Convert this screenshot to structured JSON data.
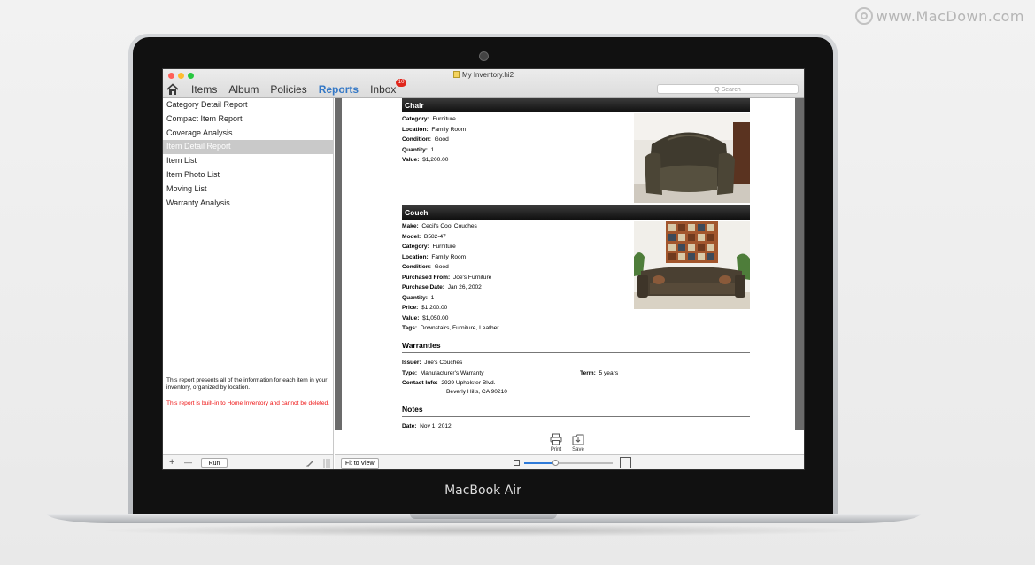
{
  "watermark": {
    "text": "www.MacDown.com"
  },
  "laptop": {
    "brand": "MacBook Air"
  },
  "window": {
    "title": "My Inventory.hi2",
    "traffic_lights": {
      "close": "#ff5f57",
      "minimize": "#febc2e",
      "zoom": "#28c840"
    },
    "accent_color": "#3478c6"
  },
  "toolbar": {
    "home_icon": "home-icon",
    "tabs": [
      {
        "label": "Items"
      },
      {
        "label": "Album"
      },
      {
        "label": "Policies"
      },
      {
        "label": "Reports",
        "active": true
      },
      {
        "label": "Inbox",
        "badge": "10"
      }
    ],
    "search_placeholder": "Q Search"
  },
  "sidebar": {
    "items": [
      {
        "label": "Category Detail Report"
      },
      {
        "label": "Compact Item Report"
      },
      {
        "label": "Coverage Analysis"
      },
      {
        "label": "Item Detail Report",
        "selected": true
      },
      {
        "label": "Item List"
      },
      {
        "label": "Item Photo List"
      },
      {
        "label": "Moving List"
      },
      {
        "label": "Warranty Analysis"
      }
    ],
    "description": "This report presents all of the information for each item in your inventory, organized by location.",
    "note": "This report is built-in to Home Inventory and cannot be deleted.",
    "bottom": {
      "add": "+",
      "remove": "—",
      "run": "Run",
      "edit_icon": "pencil-icon"
    }
  },
  "report": {
    "chair": {
      "title": "Chair",
      "fields": [
        {
          "label": "Category:",
          "value": "Furniture"
        },
        {
          "label": "Location:",
          "value": "Family Room"
        },
        {
          "label": "Condition:",
          "value": "Good"
        },
        {
          "label": "Quantity:",
          "value": "1"
        },
        {
          "label": "Value:",
          "value": "$1,200.00"
        }
      ]
    },
    "couch": {
      "title": "Couch",
      "fields": [
        {
          "label": "Make:",
          "value": "Cecil's Cool Couches"
        },
        {
          "label": "Model:",
          "value": "B582-47"
        },
        {
          "label": "Category:",
          "value": "Furniture"
        },
        {
          "label": "Location:",
          "value": "Family Room"
        },
        {
          "label": "Condition:",
          "value": "Good"
        },
        {
          "label": "Purchased From:",
          "value": "Joe's Furniture"
        },
        {
          "label": "Purchase Date:",
          "value": "Jan 26, 2002"
        },
        {
          "label": "Quantity:",
          "value": "1"
        },
        {
          "label": "Price:",
          "value": "$1,200.00"
        },
        {
          "label": "Value:",
          "value": "$1,050.00"
        },
        {
          "label": "Tags:",
          "value": "Downstairs, Furniture, Leather"
        }
      ]
    },
    "warranties": {
      "title": "Warranties",
      "issuer_label": "Issuer:",
      "issuer": "Joe's Couches",
      "type_label": "Type:",
      "type": "Manufacturer's Warranty",
      "term_label": "Term:",
      "term": "5 years",
      "contact_label": "Contact Info:",
      "contact_line1": "2929 Upholster Blvd.",
      "contact_line2": "Beverly Hills, CA 90210"
    },
    "notes": {
      "title": "Notes",
      "date_label": "Date:",
      "date": "Nov 1, 2012"
    }
  },
  "bottom_tools": {
    "print": "Print",
    "save": "Save"
  },
  "status": {
    "fit_to_view": "Fit to View",
    "zoom_level": 0.35
  }
}
